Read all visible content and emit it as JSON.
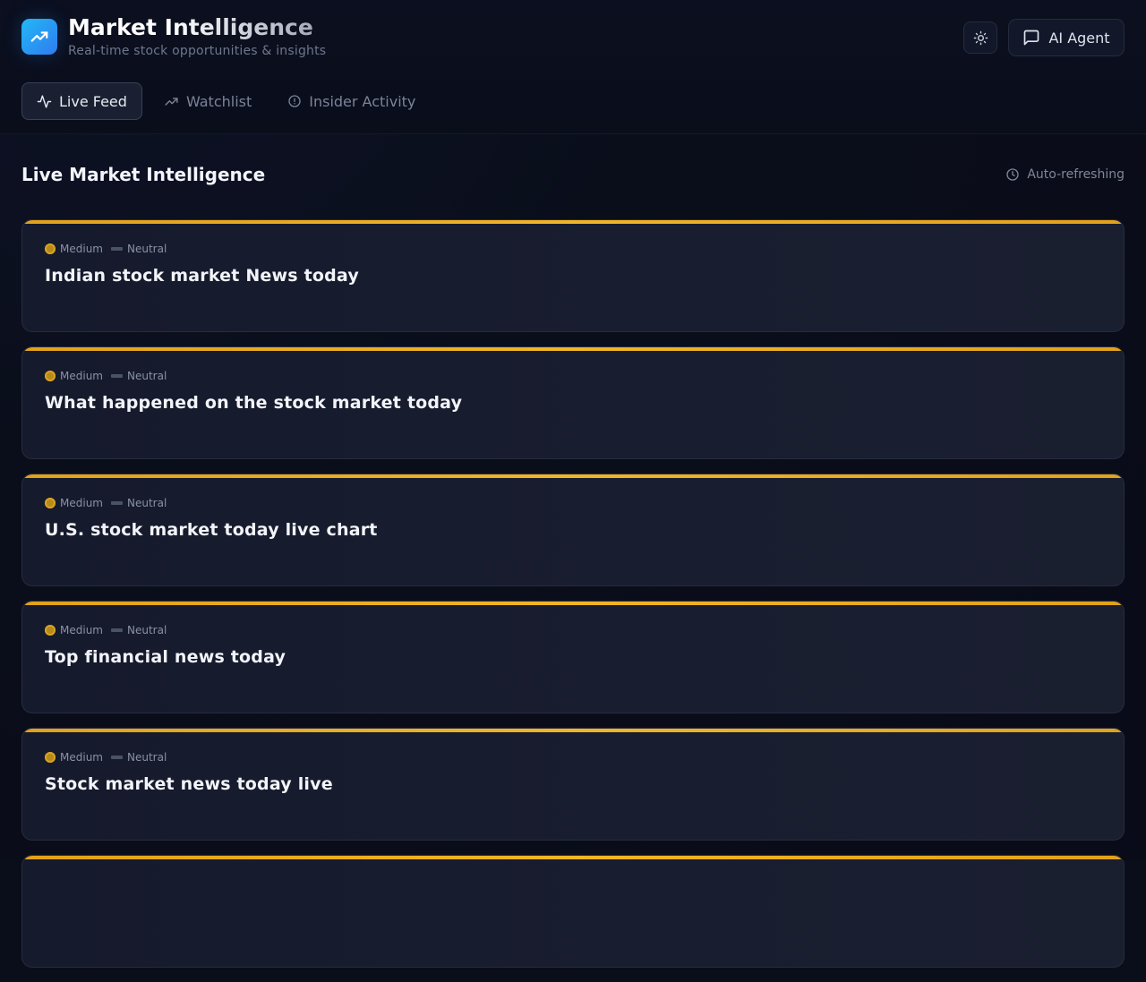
{
  "header": {
    "title": "Market Intelligence",
    "subtitle": "Real-time stock opportunities & insights",
    "agent_button": "AI Agent"
  },
  "tabs": [
    {
      "label": "Live Feed",
      "icon": "activity-icon",
      "active": true
    },
    {
      "label": "Watchlist",
      "icon": "trending-up-icon",
      "active": false
    },
    {
      "label": "Insider Activity",
      "icon": "alert-circle-icon",
      "active": false
    }
  ],
  "section": {
    "title": "Live Market Intelligence",
    "status": "Auto-refreshing"
  },
  "cards": [
    {
      "priority": "Medium",
      "sentiment": "Neutral",
      "title": "Indian stock market News today"
    },
    {
      "priority": "Medium",
      "sentiment": "Neutral",
      "title": "What happened on the stock market today"
    },
    {
      "priority": "Medium",
      "sentiment": "Neutral",
      "title": "U.S. stock market today live chart"
    },
    {
      "priority": "Medium",
      "sentiment": "Neutral",
      "title": "Top financial news today"
    },
    {
      "priority": "Medium",
      "sentiment": "Neutral",
      "title": "Stock market news today live"
    },
    {
      "priority": "",
      "sentiment": "",
      "title": ""
    }
  ],
  "colors": {
    "accent": "#2f7cf0",
    "card_stripe": "#f2b526",
    "background": "#0a0e1a"
  }
}
